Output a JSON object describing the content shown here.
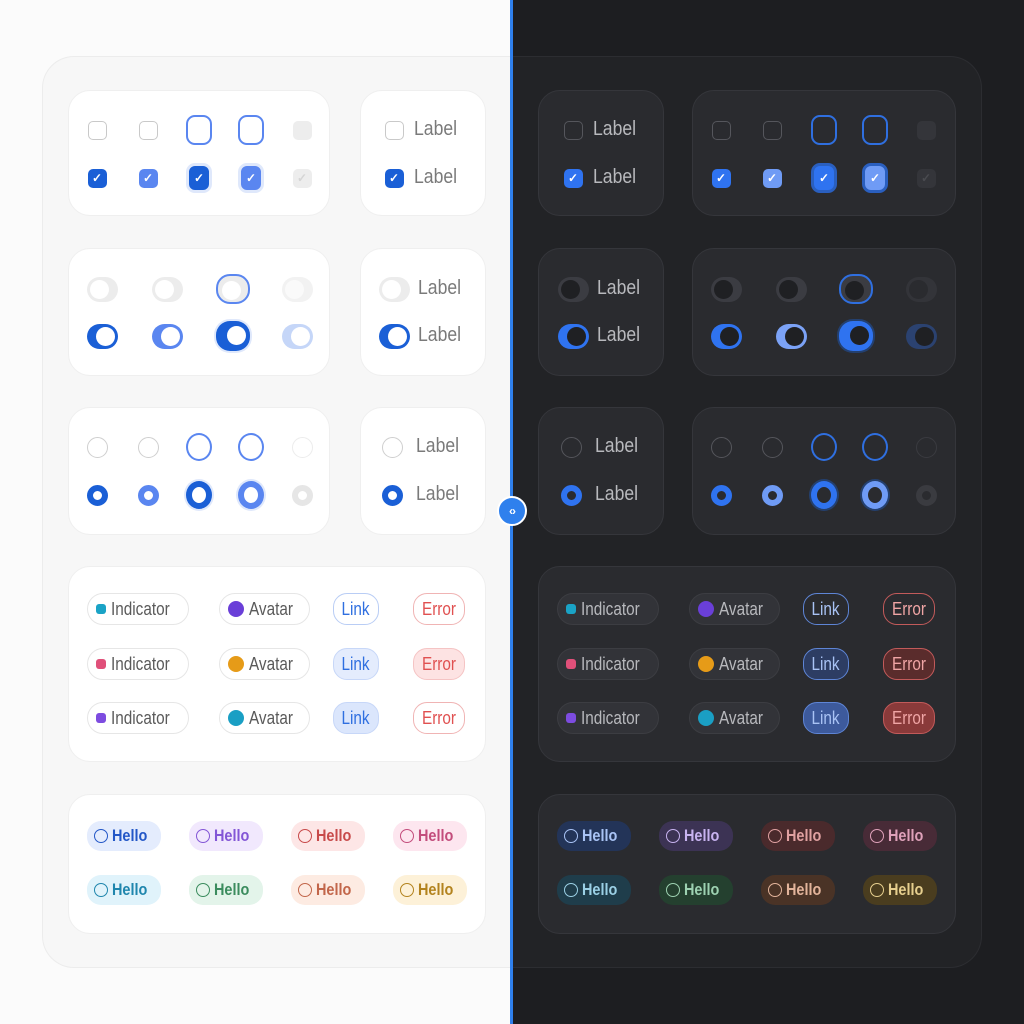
{
  "labels": {
    "label": "Label",
    "indicator": "Indicator",
    "avatar": "Avatar",
    "link": "Link",
    "error": "Error",
    "hello": "Hello"
  },
  "colors": {
    "accent": "#1a5fd6",
    "accent_hover": "#5a86f0",
    "divider": "#2f80ed",
    "light_bg": "#fbfbfb",
    "dark_bg": "#1d1e21"
  },
  "indicator_colors": [
    "#1aa3c6",
    "#e0507a",
    "#7d4ce0"
  ],
  "avatar_colors": [
    "#6a3fd8",
    "#e69b18",
    "#1a9fc4"
  ],
  "hello_colors_light": [
    {
      "bg": "#e4ecfd",
      "fg": "#2357c7"
    },
    {
      "bg": "#f1e8fd",
      "fg": "#8356d6"
    },
    {
      "bg": "#fde6e6",
      "fg": "#c84a4a"
    },
    {
      "bg": "#fde6ef",
      "fg": "#c34d7c"
    },
    {
      "bg": "#e0f3fb",
      "fg": "#1f86ad"
    },
    {
      "bg": "#e3f4ea",
      "fg": "#3b8c5e"
    },
    {
      "bg": "#fdebe2",
      "fg": "#c2664a"
    },
    {
      "bg": "#fdf1d8",
      "fg": "#b3831e"
    }
  ],
  "hello_colors_dark": [
    {
      "bg": "#233458",
      "fg": "#a9c3f5"
    },
    {
      "bg": "#3c3354",
      "fg": "#c8b3f0"
    },
    {
      "bg": "#4a2a2c",
      "fg": "#e0a1a1"
    },
    {
      "bg": "#482b37",
      "fg": "#dfa1ba"
    },
    {
      "bg": "#1f3d4b",
      "fg": "#9bd0e5"
    },
    {
      "bg": "#24402f",
      "fg": "#9dd1b1"
    },
    {
      "bg": "#4a3326",
      "fg": "#e3b49b"
    },
    {
      "bg": "#4a3d1f",
      "fg": "#e6cf8e"
    }
  ],
  "icons": {
    "check": "✓",
    "handle": "‹›"
  }
}
